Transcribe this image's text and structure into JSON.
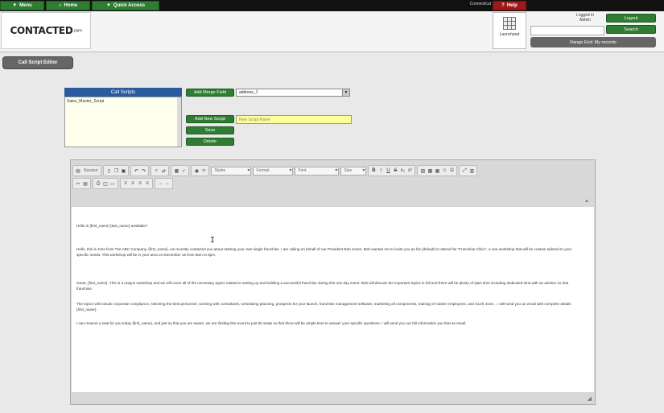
{
  "topnav": {
    "menu_label": "Menu",
    "home_label": "Home",
    "quick_access_label": "Quick Access",
    "center_text": "Connecticut",
    "help_label": "Help"
  },
  "header": {
    "logo_main": "CONTACTED",
    "logo_domain": ".com",
    "launchpad_label": "Launchpad",
    "logged_in_line1": "Logged in",
    "logged_in_line2": "Admin",
    "logout_label": "Logout",
    "search_label": "Search",
    "records_label": "Range End: My records"
  },
  "page": {
    "title_button": "Call Script Editor"
  },
  "call_scripts": {
    "header": "Call Scripts",
    "items": [
      "Sales_Master_Script"
    ]
  },
  "actions": {
    "add_merge_field": "Add Merge Field",
    "merge_field_value": "address_1",
    "add_new_script": "Add New Script",
    "script_name_placeholder": "New Script Name",
    "save": "Save",
    "delete": "Delete"
  },
  "toolbar": {
    "source_label": "Source",
    "styles_label": "Styles",
    "format_label": "Format",
    "font_label": "Font",
    "size_label": "Size"
  },
  "editor_content": {
    "p1": "Hello is {first_name} {last_name} available?",
    "p2": "Hello, this is John from The ABC Company. {first_name}, we recently contacted you about starting your own single franchise. I am calling on behalf of our President Bob Jones. Bob wanted me to invite you as his (default) to attend his \"Franchise Clinic\", a one workshop that will be custom tailored to your specific needs. This workshop will be in your area on December 16 from 9am to 5pm.",
    "p3": "Great, {first_name}. This is a unique workshop and we will cover all of the necessary topics related to setting up and building a successful franchise during this one day event. Bob will discuss the important topics in full and there will be plenty of Q&A time including dedicated time with an advisor so that franchise.",
    "p4": "The topics will include corporate compliance, selecting the best personnel, working with consultants, scheduling planning, prospects for your launch, franchise management software, marketing all components, training of master employees, and much more... I will send you an email with complete details {first_name}.",
    "p5": "I can reserve a seat for you today {first_name}, and just so that you are aware, we are limiting this event to just 50 seats so that there will be ample time to answer your specific questions. I will send you our full information you that as email."
  }
}
